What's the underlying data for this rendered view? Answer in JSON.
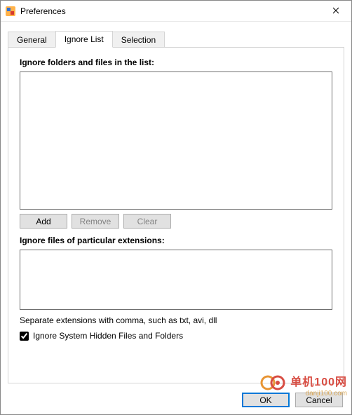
{
  "window": {
    "title": "Preferences"
  },
  "tabs": {
    "general": {
      "label": "General"
    },
    "ignore": {
      "label": "Ignore List"
    },
    "selection": {
      "label": "Selection"
    },
    "active": "ignore"
  },
  "ignore_panel": {
    "list_label": "Ignore folders and files in the list:",
    "add_label": "Add",
    "remove_label": "Remove",
    "clear_label": "Clear",
    "ext_label": "Ignore files of particular extensions:",
    "ext_hint": "Separate extensions with comma, such as txt, avi, dll",
    "hidden_checkbox_label": "Ignore System Hidden Files and Folders",
    "hidden_checked": true
  },
  "dialog": {
    "ok_label": "OK",
    "cancel_label": "Cancel"
  },
  "watermark": {
    "text": "单机100网",
    "sub": "danji100.com"
  }
}
